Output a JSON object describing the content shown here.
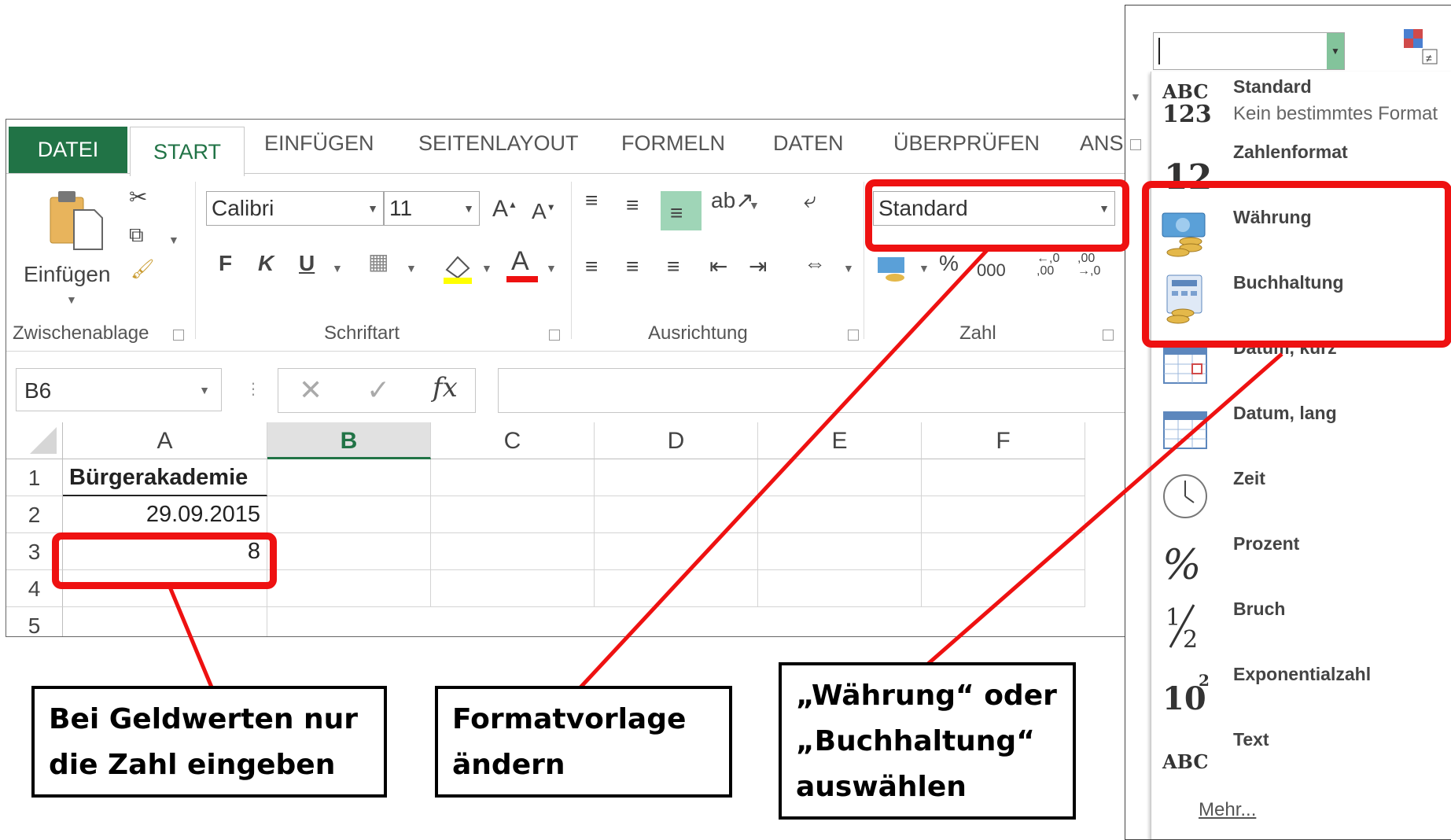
{
  "ribbon": {
    "tabs": [
      "DATEI",
      "START",
      "EINFÜGEN",
      "SEITENLAYOUT",
      "FORMELN",
      "DATEN",
      "ÜBERPRÜFEN",
      "ANS"
    ],
    "active_tab": "START",
    "clipboard": {
      "paste_label": "Einfügen",
      "group_label": "Zwischenablage"
    },
    "font": {
      "name": "Calibri",
      "size": "11",
      "bold": "F",
      "italic": "K",
      "underline": "U",
      "group_label": "Schriftart"
    },
    "alignment": {
      "group_label": "Ausrichtung"
    },
    "number": {
      "format": "Standard",
      "percent": "%",
      "thousands": "000",
      "inc_decimal": "←,0\n,00",
      "dec_decimal": ",00\n→,0",
      "group_label": "Zahl"
    }
  },
  "formula_bar": {
    "name_box": "B6",
    "fx": "fx",
    "value": ""
  },
  "grid": {
    "columns": [
      "A",
      "B",
      "C",
      "D",
      "E",
      "F"
    ],
    "selected_column": "B",
    "rows": [
      {
        "num": "1",
        "A": "Bürgerakademie"
      },
      {
        "num": "2",
        "A": "29.09.2015"
      },
      {
        "num": "3",
        "A": "8"
      },
      {
        "num": "4",
        "A": ""
      },
      {
        "num": "5",
        "A": ""
      }
    ]
  },
  "format_menu": {
    "items": [
      {
        "label": "Standard",
        "sub": "Kein bestimmtes Format",
        "icon": "abc-123-icon"
      },
      {
        "label": "Zahlenformat",
        "sub": "",
        "icon": "number-12-icon"
      },
      {
        "label": "Währung",
        "sub": "",
        "icon": "currency-icon"
      },
      {
        "label": "Buchhaltung",
        "sub": "",
        "icon": "accounting-icon"
      },
      {
        "label": "Datum, kurz",
        "sub": "",
        "icon": "calendar-short-icon"
      },
      {
        "label": "Datum, lang",
        "sub": "",
        "icon": "calendar-long-icon"
      },
      {
        "label": "Zeit",
        "sub": "",
        "icon": "clock-icon"
      },
      {
        "label": "Prozent",
        "sub": "",
        "icon": "percent-icon"
      },
      {
        "label": "Bruch",
        "sub": "",
        "icon": "fraction-icon"
      },
      {
        "label": "Exponentialzahl",
        "sub": "",
        "icon": "exponent-icon"
      },
      {
        "label": "Text",
        "sub": "",
        "icon": "abc-text-icon"
      }
    ],
    "more": "Mehr..."
  },
  "annotations": {
    "callout_1": [
      "Bei Geldwerten nur",
      "die Zahl eingeben"
    ],
    "callout_2": [
      "Formatvorlage",
      "ändern"
    ],
    "callout_3": [
      "„Währung“ oder",
      "„Buchhaltung“",
      "auswählen"
    ]
  },
  "colors": {
    "excel_green": "#217346",
    "annotation_red": "#ee1111"
  }
}
